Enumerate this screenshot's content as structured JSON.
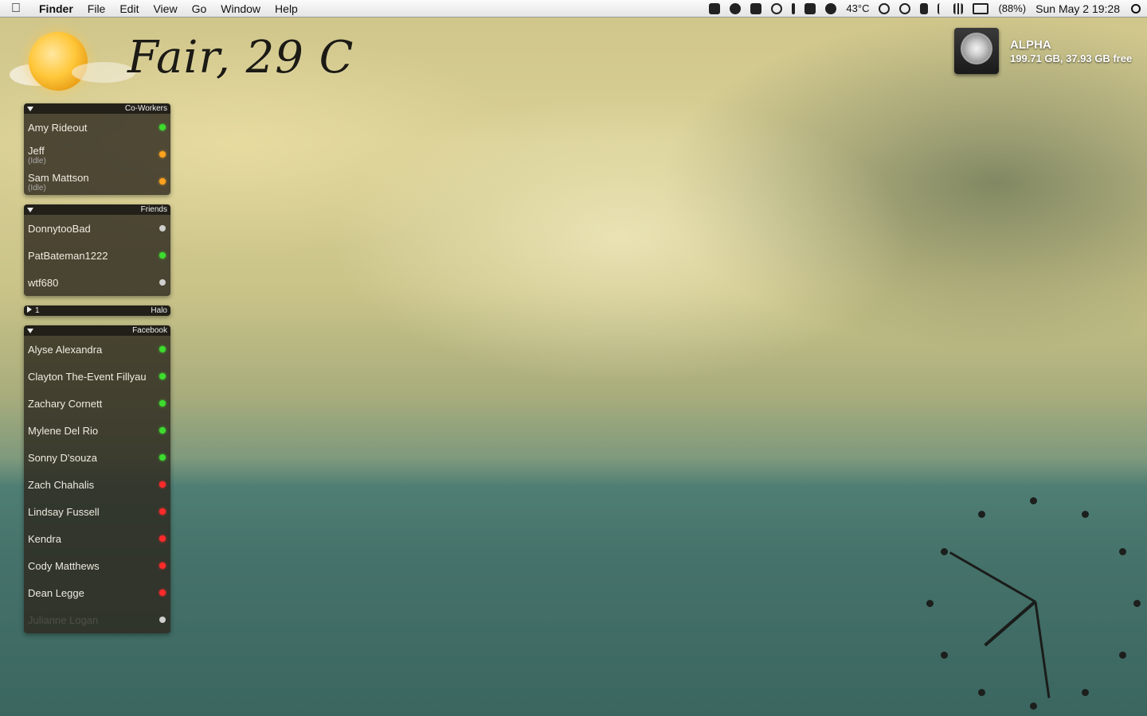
{
  "menubar": {
    "apple_icon": "apple-icon",
    "app_name": "Finder",
    "menus": [
      "File",
      "Edit",
      "View",
      "Go",
      "Window",
      "Help"
    ],
    "temperature": "43°C",
    "battery": "(88%)",
    "datetime": "Sun May 2  19:28"
  },
  "weather": {
    "text": "Fair, 29 C"
  },
  "disk": {
    "name": "ALPHA",
    "info": "199.71 GB, 37.93 GB free"
  },
  "groups": {
    "coworkers": {
      "title": "Co-Workers",
      "buddies": [
        {
          "name": "Amy Rideout",
          "status": "green",
          "sub": ""
        },
        {
          "name": "Jeff",
          "status": "orange",
          "sub": "(Idle)"
        },
        {
          "name": "Sam Mattson",
          "status": "orange",
          "sub": "(Idle)"
        }
      ]
    },
    "friends": {
      "title": "Friends",
      "buddies": [
        {
          "name": "DonnytooBad",
          "status": "gray"
        },
        {
          "name": "PatBateman1222",
          "status": "green"
        },
        {
          "name": "wtf680",
          "status": "gray"
        }
      ]
    },
    "halo": {
      "title": "Halo",
      "count": "1"
    },
    "facebook": {
      "title": "Facebook",
      "buddies": [
        {
          "name": "Alyse Alexandra",
          "status": "green"
        },
        {
          "name": "Clayton The-Event Fillyau",
          "status": "green"
        },
        {
          "name": "Zachary Cornett",
          "status": "green"
        },
        {
          "name": "Mylene Del Rio",
          "status": "green"
        },
        {
          "name": "Sonny D'souza",
          "status": "green"
        },
        {
          "name": "Zach Chahalis",
          "status": "red"
        },
        {
          "name": "Lindsay Fussell",
          "status": "red"
        },
        {
          "name": "Kendra",
          "status": "red"
        },
        {
          "name": "Cody Matthews",
          "status": "red"
        },
        {
          "name": "Dean Legge",
          "status": "red"
        },
        {
          "name": "Julianne Logan",
          "status": "gray"
        }
      ]
    }
  }
}
